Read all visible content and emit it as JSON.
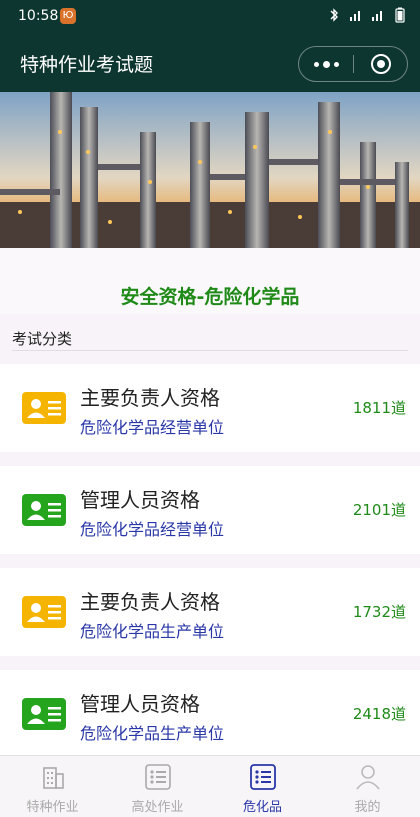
{
  "statusbar": {
    "time": "10:58",
    "notif": "Ю"
  },
  "navbar": {
    "title": "特种作业考试题"
  },
  "subject_title": "安全资格-危险化学品",
  "section_label": "考试分类",
  "colors": {
    "header_bg": "#0e3631",
    "accent_green": "#1f8a18",
    "accent_blue": "#2a37a8",
    "badge_yellow": "#f4b400",
    "badge_green": "#25a51e"
  },
  "cards": [
    {
      "title": "主要负责人资格",
      "subtitle": "危险化学品经营单位",
      "count": "1811道",
      "badge_color": "yellow"
    },
    {
      "title": "管理人员资格",
      "subtitle": "危险化学品经营单位",
      "count": "2101道",
      "badge_color": "green"
    },
    {
      "title": "主要负责人资格",
      "subtitle": "危险化学品生产单位",
      "count": "1732道",
      "badge_color": "yellow"
    },
    {
      "title": "管理人员资格",
      "subtitle": "危险化学品生产单位",
      "count": "2418道",
      "badge_color": "green"
    }
  ],
  "tabs": [
    {
      "label": "特种作业",
      "icon": "building-icon",
      "active": false
    },
    {
      "label": "高处作业",
      "icon": "list-icon",
      "active": false
    },
    {
      "label": "危化品",
      "icon": "list-icon",
      "active": true
    },
    {
      "label": "我的",
      "icon": "user-icon",
      "active": false
    }
  ]
}
